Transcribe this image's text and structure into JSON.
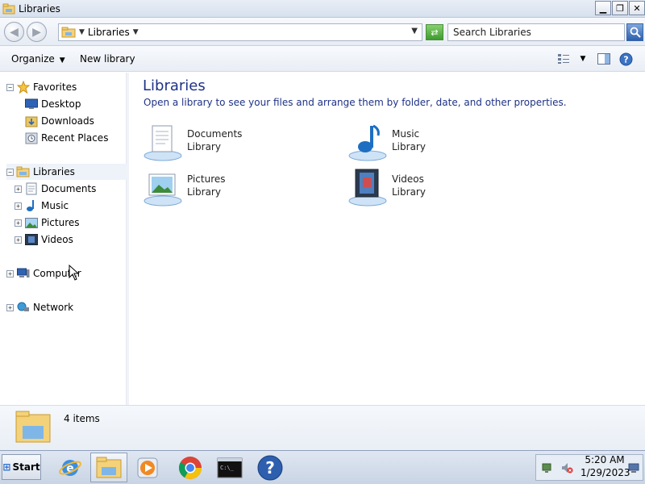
{
  "window": {
    "title": "Libraries",
    "minimize": "▁",
    "maximize": "❐",
    "close": "✕"
  },
  "address": {
    "crumb": "Libraries",
    "search_placeholder": "Search Libraries"
  },
  "toolbar": {
    "organize": "Organize",
    "new_library": "New library"
  },
  "nav": {
    "favorites": "Favorites",
    "desktop": "Desktop",
    "downloads": "Downloads",
    "recent_places": "Recent Places",
    "libraries": "Libraries",
    "documents": "Documents",
    "music": "Music",
    "pictures": "Pictures",
    "videos": "Videos",
    "computer": "Computer",
    "network": "Network"
  },
  "content": {
    "heading": "Libraries",
    "description": "Open a library to see your files and arrange them by folder, date, and other properties.",
    "libraries": [
      {
        "name": "Documents",
        "type": "Library"
      },
      {
        "name": "Music",
        "type": "Library"
      },
      {
        "name": "Pictures",
        "type": "Library"
      },
      {
        "name": "Videos",
        "type": "Library"
      }
    ]
  },
  "details": {
    "count": "4 items"
  },
  "taskbar": {
    "start": "Start",
    "time": "5:20 AM",
    "date": "1/29/2023"
  }
}
